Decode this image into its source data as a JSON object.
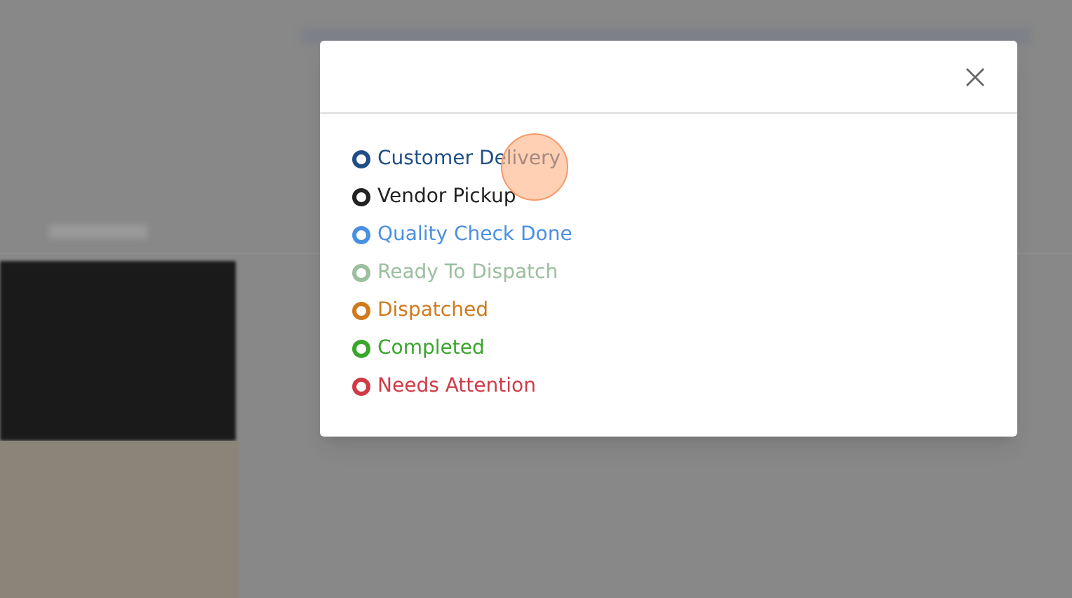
{
  "legend": {
    "items": [
      {
        "label": "Customer Delivery",
        "color": "#1f4e86"
      },
      {
        "label": "Vendor Pickup",
        "color": "#222222"
      },
      {
        "label": "Quality Check Done",
        "color": "#4a90e2"
      },
      {
        "label": "Ready To Dispatch",
        "color": "#9bbf9f"
      },
      {
        "label": "Dispatched",
        "color": "#d07a1c"
      },
      {
        "label": "Completed",
        "color": "#3aa62c"
      },
      {
        "label": "Needs Attention",
        "color": "#d03a47"
      }
    ]
  }
}
